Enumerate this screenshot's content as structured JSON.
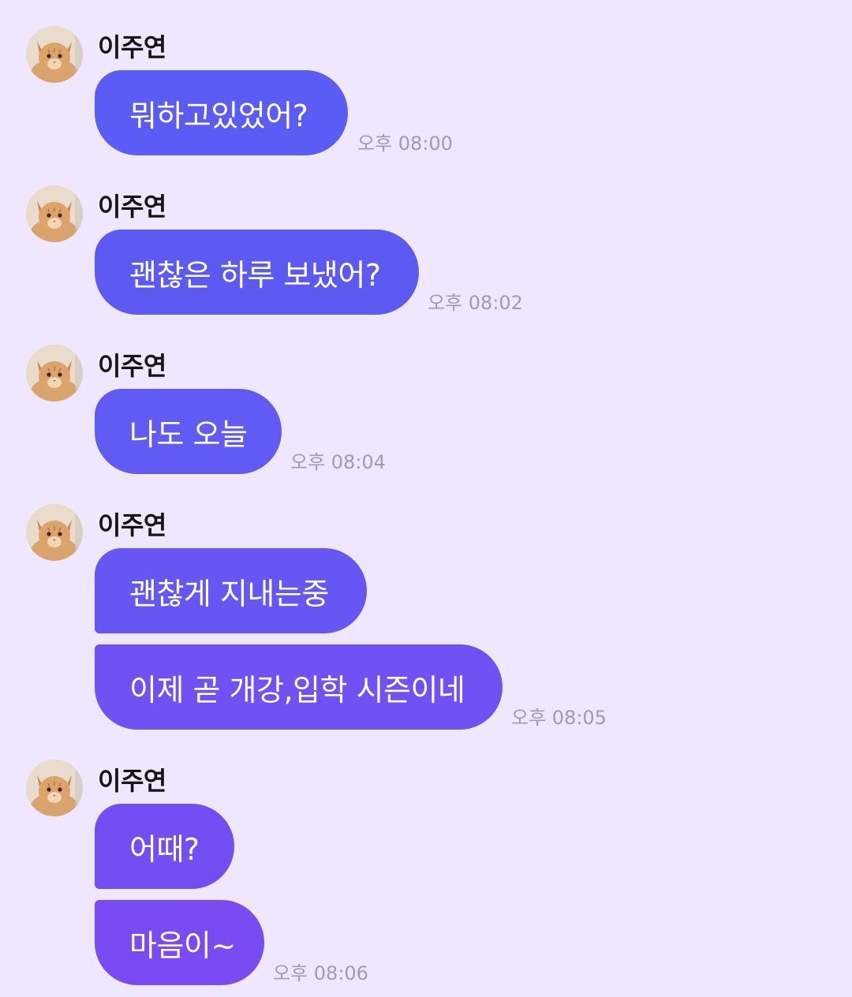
{
  "chat": {
    "sender_name": "이주연",
    "groups": [
      {
        "sender": "이주연",
        "messages": [
          "뭐하고있었어?"
        ],
        "time": "오후 08:00",
        "colors": [
          "#5b5cf5"
        ]
      },
      {
        "sender": "이주연",
        "messages": [
          "괜찮은 하루 보냈어?"
        ],
        "time": "오후 08:02",
        "colors": [
          "#5d5af4"
        ]
      },
      {
        "sender": "이주연",
        "messages": [
          "나도 오늘"
        ],
        "time": "오후 08:04",
        "colors": [
          "#615af4"
        ]
      },
      {
        "sender": "이주연",
        "messages": [
          "괜찮게 지내는중",
          "이제 곧 개강,입학 시즌이네"
        ],
        "time": "오후 08:05",
        "colors": [
          "#6656f3",
          "#6e52f3"
        ]
      },
      {
        "sender": "이주연",
        "messages": [
          "어때?",
          "마음이~"
        ],
        "time": "오후 08:06",
        "colors": [
          "#744ef2",
          "#784cf2"
        ]
      }
    ]
  },
  "theme": {
    "background": "#efe7fe",
    "timestamp_color": "#a29bb0",
    "avatar_icon": "cat-photo-avatar"
  }
}
